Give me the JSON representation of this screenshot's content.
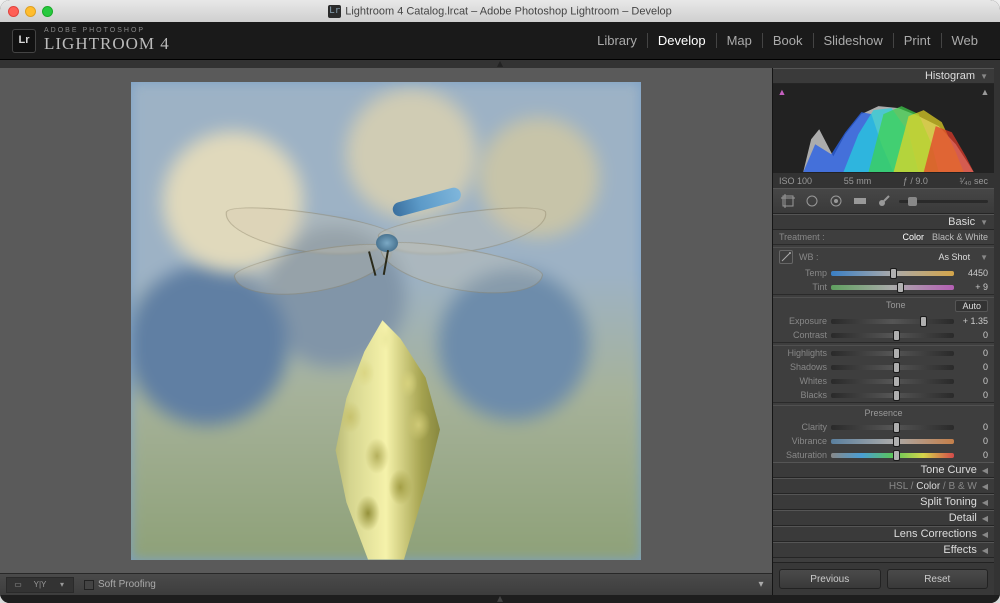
{
  "window": {
    "title": "Lightroom 4 Catalog.lrcat – Adobe Photoshop Lightroom – Develop"
  },
  "brand": {
    "logo": "Lr",
    "subtitle": "ADOBE PHOTOSHOP",
    "title": "LIGHTROOM 4"
  },
  "modules": {
    "items": [
      "Library",
      "Develop",
      "Map",
      "Book",
      "Slideshow",
      "Print",
      "Web"
    ],
    "active_index": 1
  },
  "toolbar": {
    "view_mode_y": "Y|Y",
    "soft_proofing": "Soft Proofing"
  },
  "panel": {
    "histogram": {
      "title": "Histogram"
    },
    "metadata": {
      "iso": "ISO 100",
      "focal": "55 mm",
      "aperture": "ƒ / 9.0",
      "shutter": "¹⁄₄₀ sec"
    },
    "tools": [
      "crop-icon",
      "spot-icon",
      "redeye-icon",
      "gradient-icon",
      "brush-icon"
    ],
    "basic": {
      "title": "Basic",
      "treatment_label": "Treatment :",
      "treatment_color": "Color",
      "treatment_bw": "Black & White",
      "wb_label": "WB :",
      "wb_value": "As Shot",
      "temp": {
        "label": "Temp",
        "value": "4450",
        "pos": 48
      },
      "tint": {
        "label": "Tint",
        "value": "+ 9",
        "pos": 54
      },
      "tone_label": "Tone",
      "auto": "Auto",
      "exposure": {
        "label": "Exposure",
        "value": "+ 1.35",
        "pos": 72
      },
      "contrast": {
        "label": "Contrast",
        "value": "0",
        "pos": 50
      },
      "highlights": {
        "label": "Highlights",
        "value": "0",
        "pos": 50
      },
      "shadows": {
        "label": "Shadows",
        "value": "0",
        "pos": 50
      },
      "whites": {
        "label": "Whites",
        "value": "0",
        "pos": 50
      },
      "blacks": {
        "label": "Blacks",
        "value": "0",
        "pos": 50
      },
      "presence_label": "Presence",
      "clarity": {
        "label": "Clarity",
        "value": "0",
        "pos": 50
      },
      "vibrance": {
        "label": "Vibrance",
        "value": "0",
        "pos": 50
      },
      "saturation": {
        "label": "Saturation",
        "value": "0",
        "pos": 50
      }
    },
    "closed_panels": {
      "tonecurve": "Tone Curve",
      "hsl": "HSL",
      "hsl_sep": " / ",
      "color": "Color",
      "bw": "B & W",
      "split": "Split Toning",
      "detail": "Detail",
      "lens": "Lens Corrections",
      "effects": "Effects"
    },
    "nav": {
      "prev": "Previous",
      "reset": "Reset"
    }
  }
}
